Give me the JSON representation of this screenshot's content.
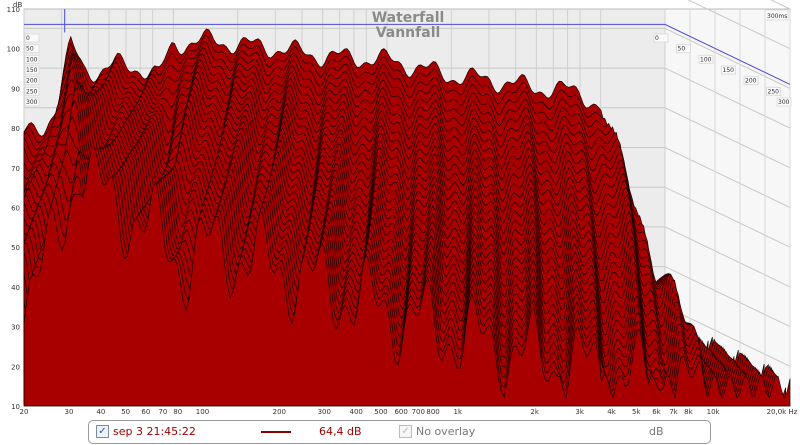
{
  "chart_data": {
    "type": "waterfall",
    "title": "Waterfall",
    "subtitle": "Vannfall",
    "ylabel": "dB",
    "xlabel": "Hz",
    "ylim": [
      10,
      110
    ],
    "xlim": [
      20,
      20000
    ],
    "y_ticks": [
      "10",
      "20",
      "30",
      "40",
      "50",
      "60",
      "70",
      "80",
      "90",
      "100",
      "110"
    ],
    "x_ticks": [
      {
        "f": 20,
        "label": "20"
      },
      {
        "f": 30,
        "label": "30"
      },
      {
        "f": 40,
        "label": "40"
      },
      {
        "f": 50,
        "label": "50"
      },
      {
        "f": 60,
        "label": "60"
      },
      {
        "f": 70,
        "label": "70"
      },
      {
        "f": 80,
        "label": "80"
      },
      {
        "f": 100,
        "label": "100"
      },
      {
        "f": 200,
        "label": "200"
      },
      {
        "f": 300,
        "label": "300"
      },
      {
        "f": 400,
        "label": "400"
      },
      {
        "f": 500,
        "label": "500"
      },
      {
        "f": 600,
        "label": "600"
      },
      {
        "f": 700,
        "label": "700"
      },
      {
        "f": 800,
        "label": "800"
      },
      {
        "f": 1000,
        "label": "1k"
      },
      {
        "f": 2000,
        "label": "2k"
      },
      {
        "f": 3000,
        "label": "3k"
      },
      {
        "f": 4000,
        "label": "4k"
      },
      {
        "f": 5000,
        "label": "5k"
      },
      {
        "f": 6000,
        "label": "6k"
      },
      {
        "f": 7000,
        "label": "7k"
      },
      {
        "f": 8000,
        "label": "8k"
      },
      {
        "f": 10000,
        "label": "10k"
      },
      {
        "f": 20000,
        "label": "20,0k Hz"
      }
    ],
    "time_axis_ms": [
      "0",
      "50",
      "100",
      "150",
      "200",
      "250",
      "300"
    ],
    "time_end_label": "300ms",
    "slice_count": 30,
    "envelope_0ms": [
      [
        20,
        63
      ],
      [
        25,
        65
      ],
      [
        29,
        72
      ],
      [
        33,
        86
      ],
      [
        38,
        80
      ],
      [
        45,
        79
      ],
      [
        55,
        81
      ],
      [
        70,
        80
      ],
      [
        85,
        78
      ],
      [
        100,
        86
      ],
      [
        150,
        87
      ],
      [
        200,
        86
      ],
      [
        300,
        85
      ],
      [
        500,
        83
      ],
      [
        1000,
        82
      ],
      [
        2000,
        78
      ],
      [
        3000,
        77
      ],
      [
        5000,
        75
      ],
      [
        8000,
        74
      ],
      [
        10000,
        70
      ],
      [
        12000,
        50
      ],
      [
        15000,
        24
      ],
      [
        20000,
        18
      ]
    ],
    "decay_db_per_100ms": [
      [
        20,
        8
      ],
      [
        33,
        4
      ],
      [
        100,
        12
      ],
      [
        1000,
        18
      ],
      [
        10000,
        20
      ],
      [
        20000,
        10
      ]
    ],
    "noise_floor_db": 15,
    "cursor": {
      "freq": 31,
      "level_db": 91
    }
  },
  "legend": {
    "measurement_name": "sep 3 21:45:22",
    "level": "64,4 dB",
    "overlay": "No overlay",
    "unit": "dB",
    "series_color": "#8b0000"
  },
  "colors": {
    "fill": "#a80000",
    "stroke": "#1a0000",
    "cursor": "#4a4ae0"
  }
}
